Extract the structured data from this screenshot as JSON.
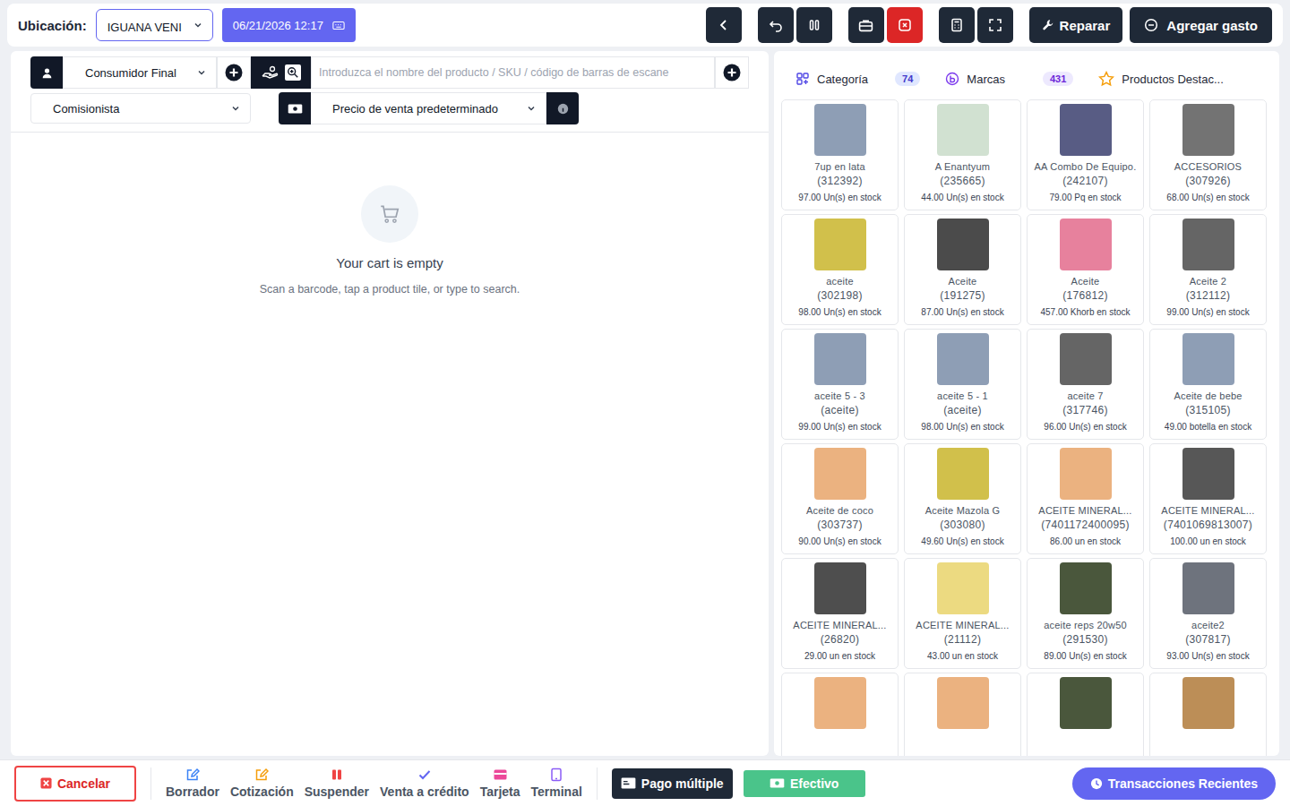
{
  "topbar": {
    "location_label": "Ubicación:",
    "location": "IGUANA VENI",
    "datetime": "06/21/2026 12:17",
    "actions": [
      {
        "label": "Reparar"
      },
      {
        "label": "Agregar gasto"
      }
    ]
  },
  "pos": {
    "customer": "Consumidor Final",
    "search_placeholder": "Introduzca el nombre del producto / SKU / código de barras de escane",
    "commission": "Comisionista",
    "price_group": "Precio de venta predeterminado"
  },
  "cart": {
    "empty_title": "Your cart is empty",
    "empty_hint": "Scan a barcode, tap a product tile, or type to search."
  },
  "tabs": [
    {
      "label": "Categoría",
      "count": "74",
      "selected": false
    },
    {
      "label": "Marcas",
      "count": "431",
      "selected": false
    },
    {
      "label": "Productos Destac...",
      "selected": false
    }
  ],
  "products": [
    {
      "kind": "tile",
      "name": "7up en lata",
      "code": "(312392)",
      "stock": "97.00 Un(s) en stock",
      "image_color": "#7a8da8"
    },
    {
      "kind": "tile",
      "name": "A Enantyum",
      "code": "(235665)",
      "stock": "44.00 Un(s) en stock",
      "image_color": "#c9dcc9"
    },
    {
      "kind": "tile",
      "name": "AA Combo De Equipo.",
      "code": "(242107)",
      "stock": "79.00 Pq en stock",
      "image_color": "#3b3f6e"
    },
    {
      "kind": "tile",
      "name": "ACCESORIOS",
      "code": "(307926)",
      "stock": "68.00 Un(s) en stock",
      "image_color": "#5b5b5b"
    },
    {
      "kind": "tile",
      "name": "aceite",
      "code": "(302198)",
      "stock": "98.00 Un(s) en stock",
      "image_color": "#c9b52c"
    },
    {
      "kind": "tile",
      "name": "Aceite",
      "code": "(191275)",
      "stock": "87.00 Un(s) en stock",
      "image_color": "#2b2b2b"
    },
    {
      "kind": "tile",
      "name": "Aceite",
      "code": "(176812)",
      "stock": "457.00 Khorb en stock",
      "image_color": "#e36b8c"
    },
    {
      "kind": "tile",
      "name": "Aceite 2",
      "code": "(312112)",
      "stock": "99.00 Un(s) en stock",
      "image_color": "#4a4a4a"
    },
    {
      "kind": "tile",
      "name": "aceite 5 - 3",
      "code": "(aceite)",
      "stock": "99.00 Un(s) en stock",
      "image_color": "#7a8da8"
    },
    {
      "kind": "tile",
      "name": "aceite 5 - 1",
      "code": "(aceite)",
      "stock": "98.00 Un(s) en stock",
      "image_color": "#7a8da8"
    },
    {
      "kind": "tile",
      "name": "aceite 7",
      "code": "(317746)",
      "stock": "96.00 Un(s) en stock",
      "image_color": "#4a4a4a"
    },
    {
      "kind": "tile",
      "name": "Aceite de bebe",
      "code": "(315105)",
      "stock": "49.00 botella en stock",
      "image_color": "#7a8da8"
    },
    {
      "kind": "tile",
      "name": "Aceite de coco",
      "code": "(303737)",
      "stock": "90.00 Un(s) en stock",
      "image_color": "#e7a46a"
    },
    {
      "kind": "tile",
      "name": "Aceite Mazola G",
      "code": "(303080)",
      "stock": "49.60 Un(s) en stock",
      "image_color": "#c9b52c"
    },
    {
      "kind": "tile",
      "name": "ACEITE MINERAL...",
      "code": "(7401172400095)",
      "stock": "86.00 un en stock",
      "image_color": "#e7a46a"
    },
    {
      "kind": "tile",
      "name": "ACEITE MINERAL...",
      "code": "(7401069813007)",
      "stock": "100.00 un en stock",
      "image_color": "#3a3a3a"
    },
    {
      "kind": "tile",
      "name": "ACEITE MINERAL...",
      "code": "(26820)",
      "stock": "29.00 un en stock",
      "image_color": "#2f2f2f"
    },
    {
      "kind": "tile",
      "name": "ACEITE MINERAL...",
      "code": "(21112)",
      "stock": "43.00 un en stock",
      "image_color": "#e9d36b"
    },
    {
      "kind": "tile",
      "name": "aceite reps 20w50",
      "code": "(291530)",
      "stock": "89.00 Un(s) en stock",
      "image_color": "#2a3a1a"
    },
    {
      "kind": "tile",
      "name": "aceite2",
      "code": "(307817)",
      "stock": "93.00 Un(s) en stock",
      "image_color": "#555b66"
    },
    {
      "kind": "image-only",
      "image_color": "#e7a46a"
    },
    {
      "kind": "image-only",
      "image_color": "#e7a46a"
    },
    {
      "kind": "image-only",
      "image_color": "#2a3a1a"
    },
    {
      "kind": "image-only",
      "image_color": "#b07a3a"
    }
  ],
  "footer": {
    "cancel": "Cancelar",
    "actions": [
      {
        "label": "Borrador",
        "color": "#3b82f6"
      },
      {
        "label": "Cotización",
        "color": "#f59e0b"
      },
      {
        "label": "Suspender",
        "color": "#ef4444"
      },
      {
        "label": "Venta a crédito",
        "color": "#6366f1"
      },
      {
        "label": "Tarjeta",
        "color": "#ec4899"
      },
      {
        "label": "Terminal",
        "color": "#8b5cf6"
      }
    ],
    "multi_pay": "Pago múltiple",
    "cash": "Efectivo",
    "recent": "Transacciones Recientes"
  }
}
